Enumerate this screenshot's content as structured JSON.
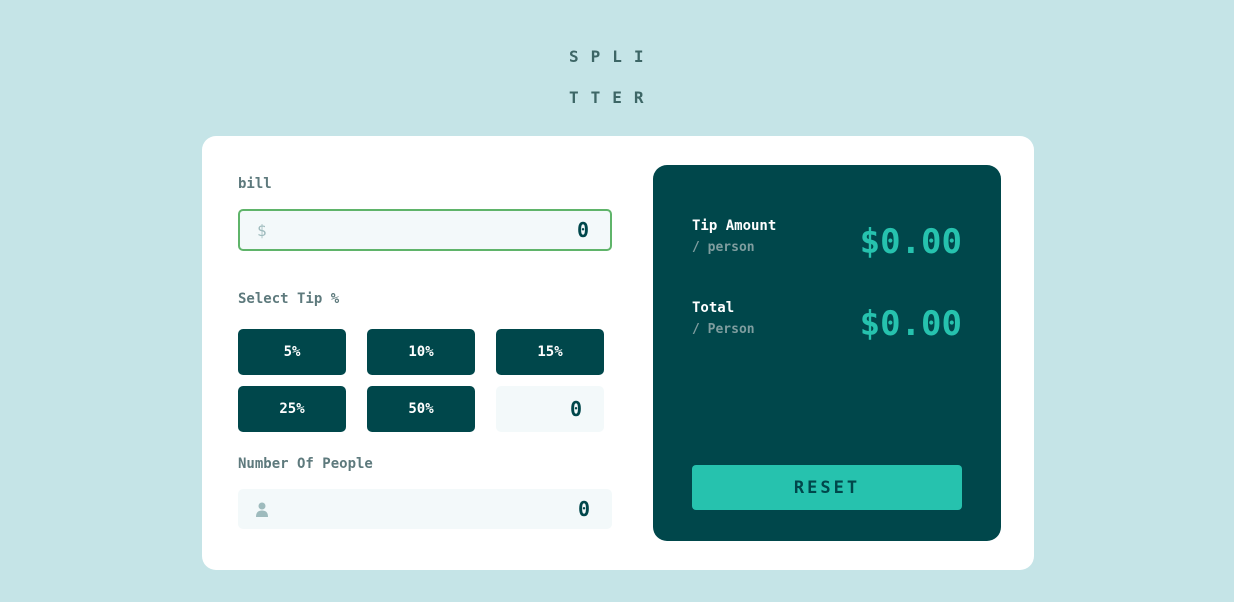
{
  "app": {
    "logo_line1": "SPLI",
    "logo_line2": "TTER"
  },
  "bill": {
    "label": "bill",
    "currency_icon": "dollar-icon",
    "currency_symbol": "$",
    "value": "0"
  },
  "tip": {
    "label": "Select Tip %",
    "options": [
      "5%",
      "10%",
      "15%",
      "25%",
      "50%"
    ],
    "custom_value": "0"
  },
  "people": {
    "label": "Number Of People",
    "icon": "person-icon",
    "value": "0"
  },
  "results": {
    "tip_title": "Tip Amount",
    "tip_sub": "/ person",
    "tip_value": "$0.00",
    "total_title": "Total",
    "total_sub": "/ Person",
    "total_value": "$0.00",
    "reset_label": "RESET"
  },
  "colors": {
    "background": "#c5e4e7",
    "card": "#ffffff",
    "dark_teal": "#00474b",
    "accent": "#26c2ae",
    "active_border": "#5fb46a"
  }
}
